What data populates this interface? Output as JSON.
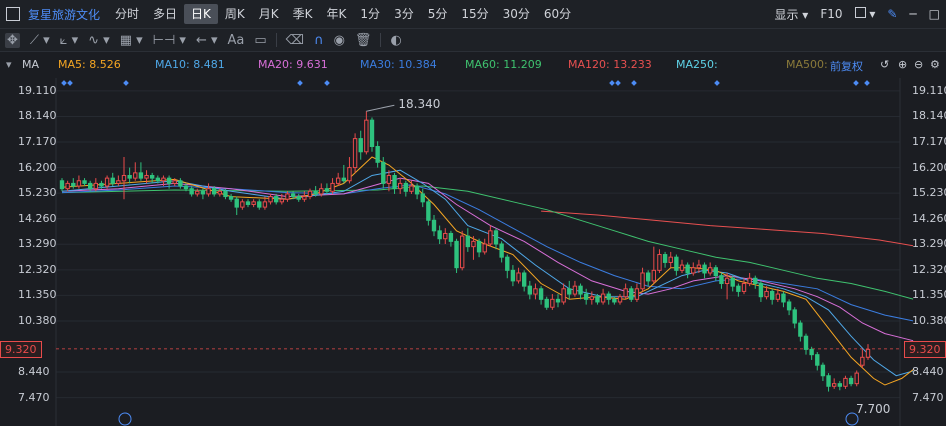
{
  "header": {
    "stock_name": "复星旅游文化",
    "periods": [
      "分时",
      "多日",
      "日K",
      "周K",
      "月K",
      "季K",
      "年K",
      "1分",
      "3分",
      "5分",
      "15分",
      "30分",
      "60分"
    ],
    "active_period": "日K",
    "display_label": "显示",
    "f10_label": "F10"
  },
  "toolbar": {
    "tools": [
      "move-icon",
      "line-icon",
      "channel-icon",
      "wave-icon",
      "ruler-icon",
      "range-icon",
      "undo-icon",
      "text-icon",
      "comment-icon",
      "eraser-icon",
      "magnet-icon",
      "eye-icon",
      "trash-icon",
      "toggle-icon"
    ],
    "text_tool_label": "Aa"
  },
  "ma_bar": {
    "label": "MA",
    "items": [
      {
        "text": "MA5: 8.526",
        "color": "#f5a623"
      },
      {
        "text": "MA10: 8.481",
        "color": "#4fa8e8"
      },
      {
        "text": "MA20: 9.631",
        "color": "#d86fd8"
      },
      {
        "text": "MA30: 10.384",
        "color": "#3b7de0"
      },
      {
        "text": "MA60: 11.209",
        "color": "#3fc26f"
      },
      {
        "text": "MA120: 13.233",
        "color": "#e85050"
      },
      {
        "text": "MA250:",
        "color": "#5fd3e8"
      },
      {
        "text": "MA500:",
        "color": "#8a7a3a"
      }
    ],
    "adjust_label": "前复权"
  },
  "axis": {
    "ticks": [
      "19.110",
      "18.140",
      "17.170",
      "16.200",
      "15.230",
      "14.260",
      "13.290",
      "12.320",
      "11.350",
      "10.380",
      "8.440",
      "7.470"
    ],
    "tick_values": [
      19.11,
      18.14,
      17.17,
      16.2,
      15.23,
      14.26,
      13.29,
      12.32,
      11.35,
      10.38,
      8.44,
      7.47
    ],
    "current_price": "9.320",
    "current_value": 9.32
  },
  "chart_data": {
    "type": "candlestick",
    "ylim": [
      7.0,
      19.6
    ],
    "annotations": [
      {
        "text": "18.340",
        "value": 18.34
      },
      {
        "text": "7.700",
        "value": 7.7
      }
    ],
    "colors": {
      "up": "#e84b4b",
      "down": "#2ec27e",
      "ma5": "#f5a623",
      "ma10": "#4fa8e8",
      "ma20": "#d86fd8",
      "ma30": "#3b7de0",
      "ma60": "#3fc26f",
      "ma120": "#e85050"
    },
    "candles": [
      [
        15.7,
        15.4,
        15.8,
        15.3
      ],
      [
        15.4,
        15.6,
        15.7,
        15.3
      ],
      [
        15.6,
        15.5,
        15.8,
        15.4
      ],
      [
        15.5,
        15.7,
        15.9,
        15.4
      ],
      [
        15.7,
        15.6,
        15.8,
        15.5
      ],
      [
        15.6,
        15.4,
        15.7,
        15.3
      ],
      [
        15.4,
        15.6,
        15.8,
        15.3
      ],
      [
        15.6,
        15.5,
        15.7,
        15.4
      ],
      [
        15.5,
        15.8,
        15.9,
        15.4
      ],
      [
        15.8,
        15.6,
        16.0,
        15.5
      ],
      [
        15.6,
        15.7,
        15.9,
        15.5
      ],
      [
        15.7,
        15.9,
        16.6,
        15.0
      ],
      [
        15.9,
        15.8,
        16.2,
        15.6
      ],
      [
        15.8,
        16.0,
        16.4,
        15.7
      ],
      [
        16.0,
        15.8,
        16.4,
        15.7
      ],
      [
        15.8,
        15.9,
        16.1,
        15.6
      ],
      [
        15.9,
        15.8,
        16.0,
        15.6
      ],
      [
        15.8,
        15.7,
        15.9,
        15.6
      ],
      [
        15.7,
        15.8,
        15.9,
        15.5
      ],
      [
        15.8,
        15.6,
        15.9,
        15.4
      ],
      [
        15.6,
        15.7,
        15.8,
        15.5
      ],
      [
        15.7,
        15.5,
        15.8,
        15.4
      ],
      [
        15.5,
        15.4,
        15.6,
        15.3
      ],
      [
        15.4,
        15.2,
        15.5,
        15.1
      ],
      [
        15.2,
        15.3,
        15.4,
        15.1
      ],
      [
        15.3,
        15.2,
        15.4,
        15.0
      ],
      [
        15.2,
        15.4,
        15.6,
        15.1
      ],
      [
        15.4,
        15.2,
        15.5,
        15.1
      ],
      [
        15.2,
        15.3,
        15.4,
        15.1
      ],
      [
        15.3,
        15.1,
        15.4,
        15.0
      ],
      [
        15.1,
        15.0,
        15.2,
        14.9
      ],
      [
        15.0,
        14.7,
        15.1,
        14.4
      ],
      [
        14.7,
        14.9,
        15.0,
        14.6
      ],
      [
        14.9,
        14.8,
        15.0,
        14.7
      ],
      [
        14.8,
        14.9,
        15.0,
        14.7
      ],
      [
        14.9,
        14.7,
        15.0,
        14.6
      ],
      [
        14.7,
        14.9,
        15.1,
        14.6
      ],
      [
        14.9,
        15.1,
        15.2,
        14.8
      ],
      [
        15.1,
        14.9,
        15.2,
        14.8
      ],
      [
        14.9,
        15.0,
        15.2,
        14.8
      ],
      [
        15.0,
        15.2,
        15.3,
        14.9
      ],
      [
        15.2,
        15.1,
        15.3,
        15.0
      ],
      [
        15.1,
        15.0,
        15.2,
        14.9
      ],
      [
        15.0,
        15.1,
        15.3,
        14.9
      ],
      [
        15.1,
        15.3,
        15.4,
        15.0
      ],
      [
        15.3,
        15.2,
        15.5,
        15.1
      ],
      [
        15.2,
        15.4,
        15.6,
        15.1
      ],
      [
        15.4,
        15.3,
        15.6,
        15.2
      ],
      [
        15.3,
        15.6,
        15.8,
        15.2
      ],
      [
        15.6,
        15.8,
        16.0,
        15.5
      ],
      [
        15.8,
        15.7,
        16.3,
        15.6
      ],
      [
        15.7,
        16.2,
        16.6,
        15.6
      ],
      [
        16.2,
        17.3,
        17.5,
        16.0
      ],
      [
        17.3,
        16.8,
        17.6,
        16.5
      ],
      [
        16.8,
        18.0,
        18.34,
        16.7
      ],
      [
        18.0,
        17.0,
        18.1,
        16.8
      ],
      [
        17.0,
        16.4,
        17.2,
        16.2
      ],
      [
        16.4,
        15.6,
        16.6,
        15.4
      ],
      [
        15.6,
        15.9,
        16.1,
        15.3
      ],
      [
        15.9,
        15.4,
        16.0,
        15.2
      ],
      [
        15.4,
        15.6,
        15.8,
        15.2
      ],
      [
        15.6,
        15.3,
        15.7,
        15.1
      ],
      [
        15.3,
        15.5,
        15.7,
        15.2
      ],
      [
        15.5,
        15.2,
        15.6,
        15.0
      ],
      [
        15.2,
        14.9,
        15.4,
        14.7
      ],
      [
        14.9,
        14.2,
        15.0,
        14.0
      ],
      [
        14.2,
        13.8,
        14.4,
        13.6
      ],
      [
        13.8,
        13.5,
        14.0,
        13.3
      ],
      [
        13.5,
        13.7,
        13.9,
        13.3
      ],
      [
        13.7,
        13.4,
        13.8,
        13.2
      ],
      [
        13.4,
        12.4,
        13.5,
        12.2
      ],
      [
        12.4,
        13.6,
        13.8,
        12.3
      ],
      [
        13.6,
        13.2,
        13.9,
        13.0
      ],
      [
        13.2,
        13.4,
        13.6,
        12.7
      ],
      [
        13.4,
        13.0,
        13.5,
        12.8
      ],
      [
        13.0,
        13.3,
        13.5,
        12.9
      ],
      [
        13.3,
        13.8,
        14.0,
        13.2
      ],
      [
        13.8,
        13.3,
        13.9,
        13.1
      ],
      [
        13.3,
        12.8,
        13.4,
        12.6
      ],
      [
        12.8,
        12.3,
        12.9,
        12.0
      ],
      [
        12.3,
        11.9,
        12.5,
        11.7
      ],
      [
        11.9,
        12.2,
        12.4,
        11.8
      ],
      [
        12.2,
        11.7,
        12.3,
        11.5
      ],
      [
        11.7,
        11.4,
        11.9,
        11.2
      ],
      [
        11.4,
        11.6,
        11.8,
        11.2
      ],
      [
        11.6,
        11.2,
        11.7,
        11.0
      ],
      [
        11.2,
        10.9,
        11.3,
        10.8
      ],
      [
        10.9,
        11.2,
        11.4,
        10.8
      ],
      [
        11.2,
        11.1,
        11.4,
        10.9
      ],
      [
        11.1,
        11.6,
        11.8,
        11.0
      ],
      [
        11.6,
        11.4,
        11.9,
        11.2
      ],
      [
        11.4,
        11.7,
        11.9,
        11.3
      ],
      [
        11.7,
        11.4,
        11.8,
        11.2
      ],
      [
        11.4,
        11.2,
        11.6,
        11.0
      ],
      [
        11.2,
        11.3,
        11.5,
        11.0
      ],
      [
        11.3,
        11.1,
        11.4,
        11.0
      ],
      [
        11.1,
        11.4,
        11.6,
        11.0
      ],
      [
        11.4,
        11.2,
        11.5,
        11.0
      ],
      [
        11.2,
        11.1,
        11.3,
        11.0
      ],
      [
        11.1,
        11.3,
        11.4,
        11.0
      ],
      [
        11.3,
        11.6,
        11.8,
        11.2
      ],
      [
        11.6,
        11.2,
        11.7,
        11.1
      ],
      [
        11.2,
        11.6,
        11.8,
        11.1
      ],
      [
        11.6,
        12.2,
        12.4,
        11.5
      ],
      [
        12.2,
        11.9,
        12.3,
        11.7
      ],
      [
        11.9,
        12.3,
        13.2,
        11.8
      ],
      [
        12.3,
        12.9,
        13.1,
        12.2
      ],
      [
        12.9,
        12.6,
        13.0,
        12.4
      ],
      [
        12.6,
        12.8,
        13.0,
        12.4
      ],
      [
        12.8,
        12.3,
        12.9,
        12.1
      ],
      [
        12.3,
        12.5,
        12.7,
        12.2
      ],
      [
        12.5,
        12.2,
        12.6,
        12.0
      ],
      [
        12.2,
        12.4,
        12.6,
        12.1
      ],
      [
        12.4,
        12.5,
        12.7,
        12.2
      ],
      [
        12.5,
        12.2,
        12.6,
        12.0
      ],
      [
        12.2,
        12.4,
        12.6,
        12.1
      ],
      [
        12.4,
        12.1,
        12.5,
        11.9
      ],
      [
        12.1,
        11.8,
        12.2,
        11.6
      ],
      [
        11.8,
        12.0,
        12.2,
        11.2
      ],
      [
        12.0,
        11.7,
        12.1,
        11.5
      ],
      [
        11.7,
        11.5,
        11.8,
        11.3
      ],
      [
        11.5,
        11.8,
        12.0,
        11.4
      ],
      [
        11.8,
        12.0,
        12.2,
        11.7
      ],
      [
        12.0,
        11.8,
        12.1,
        11.6
      ],
      [
        11.8,
        11.3,
        11.9,
        11.1
      ],
      [
        11.3,
        11.5,
        11.7,
        11.2
      ],
      [
        11.5,
        11.2,
        11.6,
        11.0
      ],
      [
        11.2,
        11.4,
        11.6,
        11.1
      ],
      [
        11.4,
        11.1,
        11.5,
        10.9
      ],
      [
        11.1,
        10.8,
        11.2,
        10.6
      ],
      [
        10.8,
        10.3,
        10.9,
        10.1
      ],
      [
        10.3,
        9.8,
        10.4,
        9.6
      ],
      [
        9.8,
        9.3,
        9.9,
        9.1
      ],
      [
        9.3,
        9.1,
        9.4,
        8.9
      ],
      [
        9.1,
        8.7,
        9.2,
        8.5
      ],
      [
        8.7,
        8.3,
        8.8,
        8.1
      ],
      [
        8.3,
        7.9,
        8.4,
        7.7
      ],
      [
        7.9,
        8.0,
        8.2,
        7.8
      ],
      [
        8.0,
        7.9,
        8.1,
        7.75
      ],
      [
        7.9,
        8.2,
        8.3,
        7.8
      ],
      [
        8.2,
        8.0,
        8.3,
        7.9
      ],
      [
        8.0,
        8.4,
        8.5,
        7.9
      ],
      [
        8.7,
        9.0,
        9.3,
        8.6
      ],
      [
        9.0,
        9.3,
        9.5,
        8.9
      ]
    ],
    "ma": {
      "ma5": [
        [
          0,
          15.45
        ],
        [
          10,
          15.6
        ],
        [
          20,
          15.75
        ],
        [
          30,
          15.1
        ],
        [
          40,
          15.0
        ],
        [
          45,
          15.2
        ],
        [
          50,
          15.6
        ],
        [
          55,
          16.6
        ],
        [
          58,
          16.3
        ],
        [
          62,
          15.6
        ],
        [
          66,
          14.8
        ],
        [
          70,
          13.8
        ],
        [
          75,
          13.3
        ],
        [
          80,
          12.9
        ],
        [
          85,
          11.8
        ],
        [
          90,
          11.2
        ],
        [
          95,
          11.3
        ],
        [
          100,
          11.2
        ],
        [
          104,
          11.6
        ],
        [
          108,
          12.4
        ],
        [
          112,
          12.4
        ],
        [
          116,
          12.3
        ],
        [
          120,
          11.9
        ],
        [
          124,
          11.7
        ],
        [
          128,
          11.5
        ],
        [
          132,
          11.2
        ],
        [
          136,
          10.1
        ],
        [
          140,
          9.0
        ],
        [
          144,
          8.2
        ],
        [
          146,
          7.95
        ],
        [
          149,
          8.2
        ],
        [
          151,
          8.53
        ]
      ],
      "ma10": [
        [
          0,
          15.3
        ],
        [
          10,
          15.5
        ],
        [
          20,
          15.7
        ],
        [
          30,
          15.3
        ],
        [
          40,
          15.0
        ],
        [
          50,
          15.3
        ],
        [
          55,
          15.9
        ],
        [
          60,
          16.1
        ],
        [
          64,
          15.6
        ],
        [
          68,
          15.0
        ],
        [
          72,
          14.0
        ],
        [
          78,
          13.5
        ],
        [
          84,
          12.5
        ],
        [
          90,
          11.6
        ],
        [
          96,
          11.3
        ],
        [
          102,
          11.3
        ],
        [
          106,
          11.7
        ],
        [
          110,
          12.1
        ],
        [
          114,
          12.3
        ],
        [
          118,
          12.2
        ],
        [
          122,
          11.9
        ],
        [
          128,
          11.6
        ],
        [
          132,
          11.3
        ],
        [
          136,
          10.8
        ],
        [
          140,
          9.8
        ],
        [
          144,
          8.9
        ],
        [
          148,
          8.3
        ],
        [
          151,
          8.48
        ]
      ],
      "ma20": [
        [
          0,
          15.3
        ],
        [
          10,
          15.4
        ],
        [
          20,
          15.6
        ],
        [
          30,
          15.4
        ],
        [
          40,
          15.1
        ],
        [
          50,
          15.2
        ],
        [
          55,
          15.5
        ],
        [
          60,
          15.8
        ],
        [
          65,
          15.6
        ],
        [
          70,
          14.8
        ],
        [
          76,
          14.0
        ],
        [
          82,
          13.4
        ],
        [
          88,
          12.6
        ],
        [
          94,
          11.9
        ],
        [
          100,
          11.5
        ],
        [
          104,
          11.4
        ],
        [
          108,
          11.6
        ],
        [
          112,
          11.9
        ],
        [
          118,
          12.1
        ],
        [
          124,
          11.9
        ],
        [
          130,
          11.6
        ],
        [
          134,
          11.3
        ],
        [
          138,
          10.9
        ],
        [
          142,
          10.3
        ],
        [
          146,
          9.9
        ],
        [
          151,
          9.63
        ]
      ],
      "ma30": [
        [
          0,
          15.25
        ],
        [
          10,
          15.35
        ],
        [
          20,
          15.5
        ],
        [
          30,
          15.4
        ],
        [
          40,
          15.25
        ],
        [
          50,
          15.2
        ],
        [
          56,
          15.4
        ],
        [
          62,
          15.55
        ],
        [
          68,
          15.2
        ],
        [
          74,
          14.6
        ],
        [
          80,
          13.9
        ],
        [
          86,
          13.2
        ],
        [
          92,
          12.6
        ],
        [
          98,
          12.1
        ],
        [
          104,
          11.7
        ],
        [
          110,
          11.6
        ],
        [
          116,
          11.9
        ],
        [
          122,
          12.0
        ],
        [
          128,
          11.8
        ],
        [
          134,
          11.6
        ],
        [
          140,
          11.0
        ],
        [
          146,
          10.6
        ],
        [
          151,
          10.38
        ]
      ],
      "ma60": [
        [
          0,
          15.25
        ],
        [
          20,
          15.35
        ],
        [
          40,
          15.3
        ],
        [
          56,
          15.35
        ],
        [
          64,
          15.5
        ],
        [
          72,
          15.3
        ],
        [
          80,
          14.9
        ],
        [
          86,
          14.6
        ],
        [
          92,
          14.2
        ],
        [
          98,
          13.8
        ],
        [
          104,
          13.4
        ],
        [
          110,
          13.1
        ],
        [
          116,
          12.8
        ],
        [
          122,
          12.6
        ],
        [
          128,
          12.3
        ],
        [
          134,
          12.0
        ],
        [
          140,
          11.8
        ],
        [
          146,
          11.5
        ],
        [
          151,
          11.21
        ]
      ],
      "ma120": [
        [
          85,
          14.55
        ],
        [
          95,
          14.4
        ],
        [
          105,
          14.2
        ],
        [
          115,
          14.0
        ],
        [
          125,
          13.85
        ],
        [
          135,
          13.7
        ],
        [
          145,
          13.45
        ],
        [
          151,
          13.23
        ]
      ]
    }
  }
}
